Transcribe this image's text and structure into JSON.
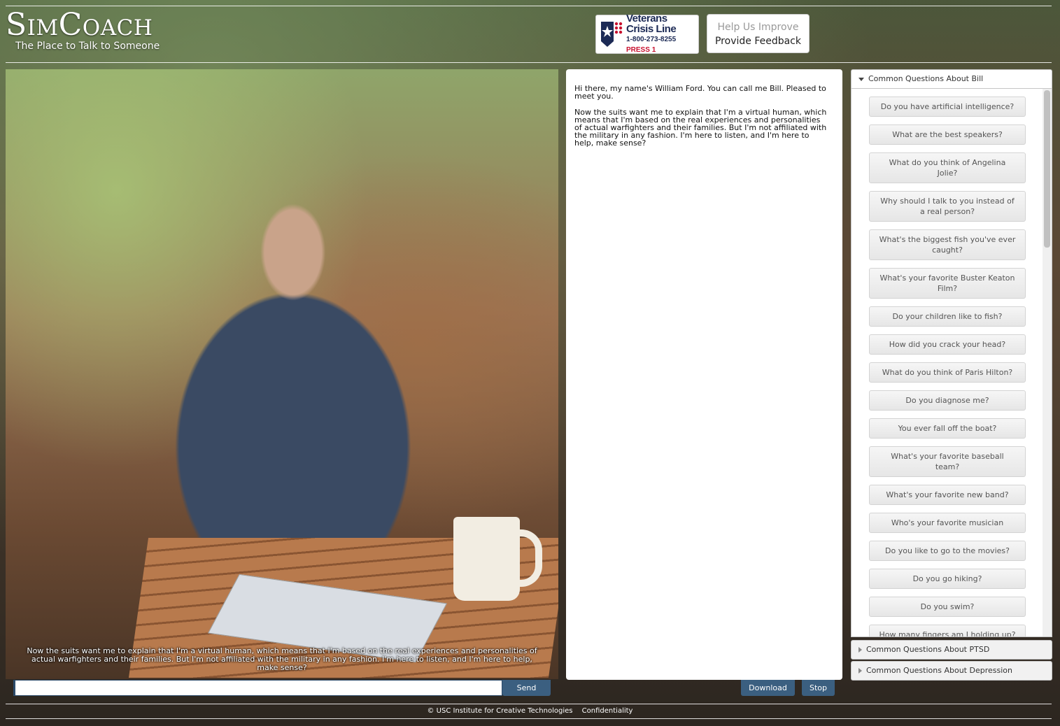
{
  "header": {
    "title": "SimCoach",
    "tagline": "The Place to Talk to Someone",
    "crisis": {
      "line1": "Veterans",
      "line2": "Crisis Line",
      "phone": "1-800-273-8255",
      "press": "PRESS",
      "press_num": "1"
    },
    "feedback": {
      "line1": "Help Us Improve",
      "line2": "Provide Feedback"
    }
  },
  "video": {
    "caption": "Now the suits want me to explain that I'm a virtual human, which means that I'm based on the real experiences and personalities of actual warfighters and their families. But I'm not affiliated with the military in any fashion. I'm here to listen, and I'm here to help, make sense?"
  },
  "transcript": {
    "messages": [
      "Hi there, my name's William Ford. You can call me Bill. Pleased to meet you.",
      "Now the suits want me to explain that I'm a virtual human, which means that I'm based on the real experiences and personalities of actual warfighters and their families. But I'm not affiliated with the military in any fashion. I'm here to listen, and I'm here to help, make sense?"
    ]
  },
  "questions": {
    "sections": [
      {
        "label": "Common Questions About Bill",
        "expanded": true
      },
      {
        "label": "Common Questions About PTSD",
        "expanded": false
      },
      {
        "label": "Common Questions About Depression",
        "expanded": false
      }
    ],
    "bill": [
      "Do you have artificial intelligence?",
      "What are the best speakers?",
      "What do you think of Angelina Jolie?",
      "Why should I talk to you instead of a real person?",
      "What's the biggest fish you've ever caught?",
      "What's your favorite Buster Keaton Film?",
      "Do your children like to fish?",
      "How did you crack your head?",
      "What do you think of Paris Hilton?",
      "Do you diagnose me?",
      "You ever fall off the boat?",
      "What's your favorite baseball team?",
      "What's your favorite new band?",
      "Who's your favorite musician",
      "Do you like to go to the movies?",
      "Do you go hiking?",
      "Do you swim?",
      "How many fingers am I holding up?"
    ]
  },
  "controls": {
    "input_value": "",
    "send_label": "Send",
    "download_label": "Download",
    "stop_label": "Stop"
  },
  "footer": {
    "copyright": "© USC Institute for Creative Technologies",
    "confidentiality": "Confidentiality"
  },
  "colors": {
    "button_dark": "#3b5f80",
    "crisis_navy": "#1c2a55",
    "crisis_red": "#c8102e"
  }
}
